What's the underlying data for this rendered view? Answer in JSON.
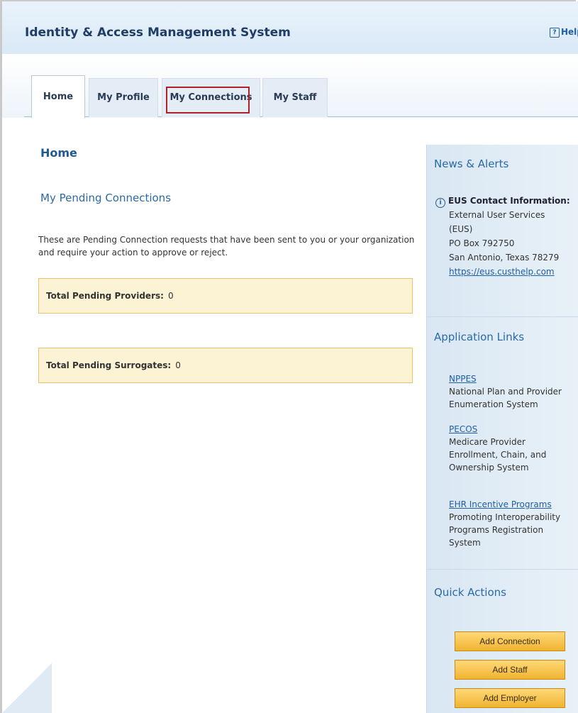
{
  "header": {
    "app_title": "Identity & Access Management System",
    "help_label": "Help"
  },
  "tabs": [
    {
      "label": "Home",
      "active": true
    },
    {
      "label": "My Profile",
      "active": false
    },
    {
      "label": "My Connections",
      "active": false,
      "highlighted": true
    },
    {
      "label": "My Staff",
      "active": false
    }
  ],
  "main": {
    "page_title": "Home",
    "section_title": "My Pending Connections",
    "description": "These are Pending Connection requests that have been sent to you or your organization and require your action to approve or reject.",
    "pending_providers_label": "Total Pending Providers:",
    "pending_providers_value": "0",
    "pending_surrogates_label": "Total Pending Surrogates:",
    "pending_surrogates_value": "0"
  },
  "sidebar": {
    "news_heading": "News & Alerts",
    "eus_title": "EUS Contact Information:",
    "eus_lines": [
      "External User Services",
      "(EUS)",
      "PO Box 792750",
      "San Antonio, Texas 78279"
    ],
    "eus_link": "https://eus.custhelp.com",
    "app_links_heading": "Application Links",
    "app_links": [
      {
        "name": "NPPES",
        "description": "National Plan and Provider Enumeration System"
      },
      {
        "name": "PECOS",
        "description": "Medicare Provider Enrollment, Chain, and Ownership System"
      },
      {
        "name": "EHR Incentive Programs",
        "description": "Promoting Interoperability Programs Registration System"
      }
    ],
    "quick_actions_heading": "Quick Actions",
    "quick_actions": [
      "Add Connection",
      "Add Staff",
      "Add Employer"
    ]
  },
  "colors": {
    "highlight_border": "#b0222a",
    "link": "#1f5fa6",
    "heading": "#2a6aa8",
    "pending_box_bg": "#fbf3d3",
    "button": "#f0b330"
  }
}
